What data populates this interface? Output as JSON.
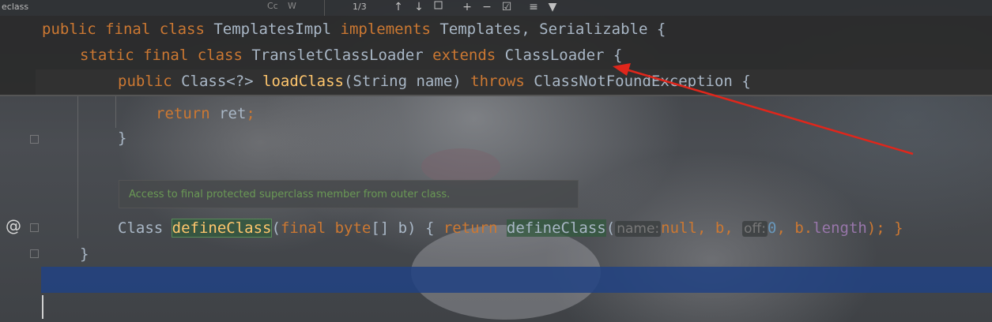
{
  "find_bar": {
    "query": "eclass",
    "match_case_label": "Cc",
    "words_label": "W",
    "match_count": "1/3",
    "icons": [
      "arrow-up-icon",
      "arrow-down-icon",
      "select-all-icon",
      "add-selection-icon",
      "remove-selection-icon",
      "select-occurrences-icon",
      "sort-icon",
      "filter-icon"
    ]
  },
  "code": {
    "line1": {
      "kw1": "public final class ",
      "name": "TemplatesImpl ",
      "kw2": "implements ",
      "rest": "Templates, Serializable {"
    },
    "line2": {
      "kw1": "static final class ",
      "name": "TransletClassLoader ",
      "kw2": "extends ",
      "rest": "ClassLoader {"
    },
    "line3": {
      "kw1": "public ",
      "type": "Class<?> ",
      "fn": "loadClass",
      "args": "(String name) ",
      "kw2": "throws ",
      "rest": "ClassNotFoundException {"
    },
    "line4": {
      "kw": "return ",
      "rest": "ret",
      "semi": ";"
    },
    "line5": "}",
    "line6": {
      "type": "Class ",
      "fn": "defineClass",
      "p1": "(",
      "kw1": "final byte",
      "p2": "[] b) { ",
      "kw2": "return ",
      "fn2": "defineClass",
      "p3": "(",
      "hint1": "name:",
      "v1": "null",
      "c1": ", b, ",
      "hint2": "off:",
      "v2": "0",
      "c2": ", b.",
      "fld": "length",
      "p4": "); }"
    },
    "line7": "}"
  },
  "tooltip": "Access to final protected superclass member from outer class.",
  "gutter_marker": "@",
  "colors": {
    "keyword": "#cc7832",
    "function": "#ffc66d",
    "number": "#6897bb",
    "field": "#9876aa",
    "annotation_arrow": "#e0261b",
    "selection": "#214283"
  }
}
